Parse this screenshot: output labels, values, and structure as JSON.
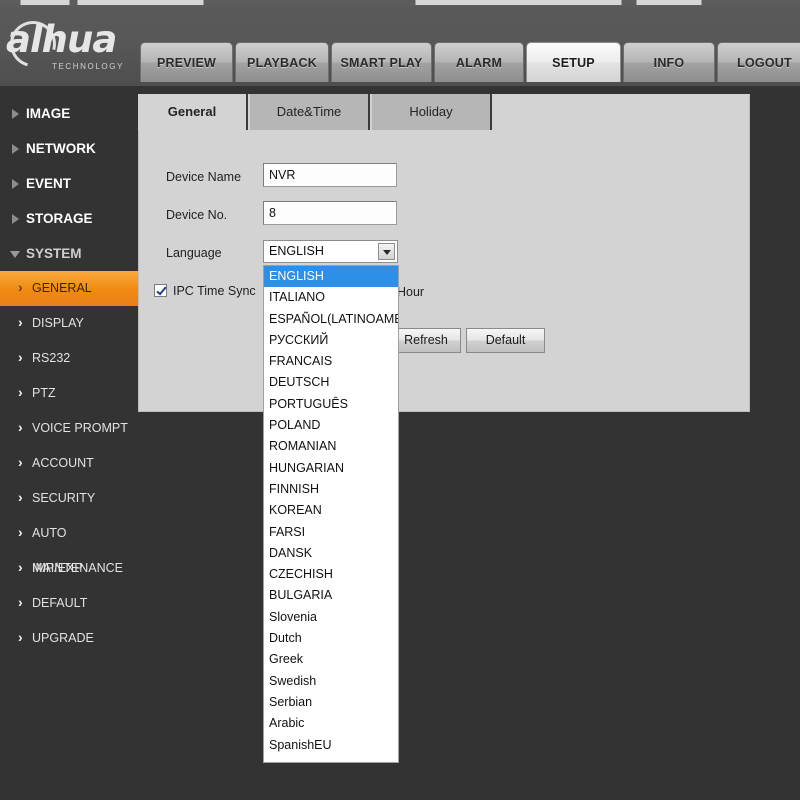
{
  "window": {
    "background_color": "#333333",
    "header_color": "#575757",
    "accent_color": "#f08a12"
  },
  "brand": {
    "name": "alhua",
    "tagline": "TECHNOLOGY"
  },
  "nav": {
    "tabs": [
      {
        "label": "PREVIEW",
        "active": false
      },
      {
        "label": "PLAYBACK",
        "active": false
      },
      {
        "label": "SMART PLAY",
        "active": false
      },
      {
        "label": "ALARM",
        "active": false
      },
      {
        "label": "SETUP",
        "active": true
      },
      {
        "label": "INFO",
        "active": false
      },
      {
        "label": "LOGOUT",
        "active": false
      }
    ]
  },
  "sidebar": {
    "items": [
      {
        "label": "IMAGE",
        "type": "group",
        "expanded": false,
        "active": false
      },
      {
        "label": "NETWORK",
        "type": "group",
        "expanded": false,
        "active": false
      },
      {
        "label": "EVENT",
        "type": "group",
        "expanded": false,
        "active": false
      },
      {
        "label": "STORAGE",
        "type": "group",
        "expanded": false,
        "active": false
      },
      {
        "label": "SYSTEM",
        "type": "group",
        "expanded": true,
        "active": false
      },
      {
        "label": "GENERAL",
        "type": "sub",
        "expanded": false,
        "active": true
      },
      {
        "label": "DISPLAY",
        "type": "sub",
        "expanded": false,
        "active": false
      },
      {
        "label": "RS232",
        "type": "sub",
        "expanded": false,
        "active": false
      },
      {
        "label": "PTZ",
        "type": "sub",
        "expanded": false,
        "active": false
      },
      {
        "label": "VOICE PROMPT",
        "type": "sub",
        "expanded": false,
        "active": false
      },
      {
        "label": "ACCOUNT",
        "type": "sub",
        "expanded": false,
        "active": false
      },
      {
        "label": "SECURITY",
        "type": "sub",
        "expanded": false,
        "active": false
      },
      {
        "label": "AUTO MAINTENANCE",
        "type": "sub",
        "expanded": false,
        "active": false
      },
      {
        "label": "IMP/EXP",
        "type": "sub",
        "expanded": false,
        "active": false
      },
      {
        "label": "DEFAULT",
        "type": "sub",
        "expanded": false,
        "active": false
      },
      {
        "label": "UPGRADE",
        "type": "sub",
        "expanded": false,
        "active": false
      }
    ]
  },
  "content": {
    "tabs": [
      {
        "label": "General",
        "active": true
      },
      {
        "label": "Date&Time",
        "active": false
      },
      {
        "label": "Holiday",
        "active": false
      }
    ],
    "form": {
      "device_name": {
        "label": "Device Name",
        "value": "NVR"
      },
      "device_no": {
        "label": "Device No.",
        "value": "8"
      },
      "language": {
        "label": "Language",
        "value": "ENGLISH"
      },
      "ipc_time_sync": {
        "label": "IPC Time Sync",
        "checked": true,
        "unit": "Hour"
      }
    },
    "buttons": {
      "refresh": "Refresh",
      "default": "Default"
    }
  },
  "language_dropdown": {
    "open": true,
    "selected": "ENGLISH",
    "options": [
      "ENGLISH",
      "ITALIANO",
      "ESPAÑOL(LATINOAMÉRIC",
      "РУССКИЙ",
      "FRANCAIS",
      "DEUTSCH",
      "PORTUGUÊS",
      "POLAND",
      "ROMANIAN",
      "HUNGARIAN",
      "FINNISH",
      "KOREAN",
      "FARSI",
      "DANSK",
      "CZECHISH",
      "BULGARIA",
      "Slovenia",
      "Dutch",
      "Greek",
      "Swedish",
      "Serbian",
      "Arabic",
      "SpanishEU"
    ]
  }
}
